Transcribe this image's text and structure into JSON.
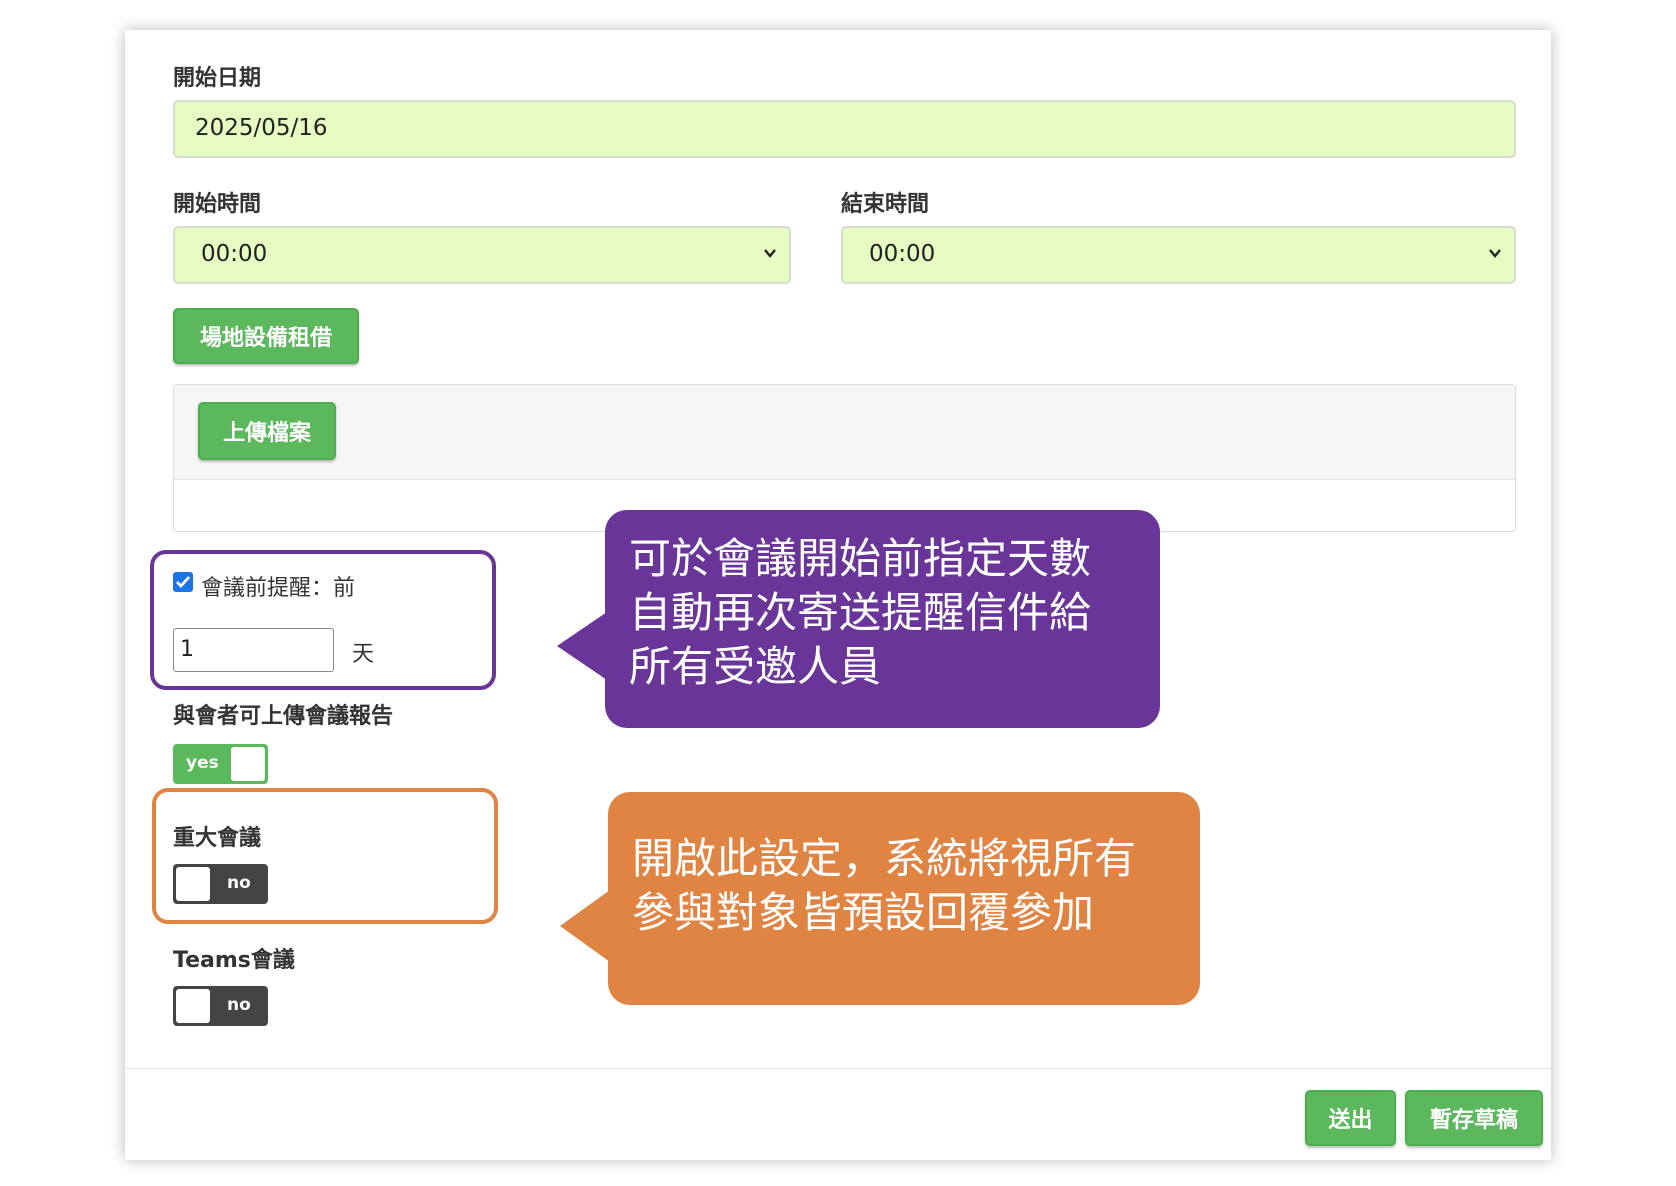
{
  "form": {
    "start_date_label": "開始日期",
    "start_date_value": "2025/05/16",
    "start_time_label": "開始時間",
    "start_time_value": "00:00",
    "end_time_label": "結束時間",
    "end_time_value": "00:00",
    "venue_button": "場地設備租借",
    "upload_button": "上傳檔案",
    "reminder_label": "會議前提醒：前",
    "reminder_days_value": "1",
    "reminder_unit": "天",
    "upload_report_label": "與會者可上傳會議報告",
    "upload_report_toggle": "yes",
    "major_meeting_label": "重大會議",
    "major_meeting_toggle": "no",
    "teams_label": "Teams會議",
    "teams_toggle": "no"
  },
  "callouts": {
    "reminder_text": [
      "可於會議開始前指定天數",
      "自動再次寄送提醒信件給",
      "所有受邀人員"
    ],
    "major_text": [
      "開啟此設定，系統將視所有",
      "參與對象皆預設回覆參加"
    ]
  },
  "footer": {
    "submit_button": "送出",
    "draft_button": "暫存草稿"
  },
  "colors": {
    "input_bg": "#e6fcc2",
    "button_green": "#5cb85c",
    "callout_purple": "#6a3598",
    "callout_orange": "#e08444",
    "toggle_dark": "#444444"
  }
}
